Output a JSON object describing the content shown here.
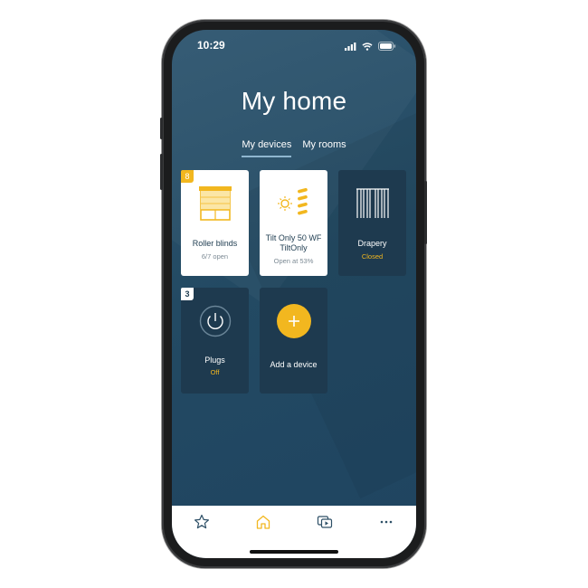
{
  "status_bar": {
    "time": "10:29"
  },
  "header": {
    "title": "My home"
  },
  "tabs": [
    {
      "label": "My devices",
      "active": true
    },
    {
      "label": "My rooms",
      "active": false
    }
  ],
  "devices": [
    {
      "badge": "8",
      "name": "Roller blinds",
      "status": "6/7 open",
      "icon": "roller-blind-icon"
    },
    {
      "name": "Tilt Only 50 WF TiltOnly",
      "status": "Open at 53%",
      "icon": "tilt-sun-icon"
    },
    {
      "name": "Drapery",
      "status": "Closed",
      "icon": "drapery-icon"
    },
    {
      "badge": "3",
      "name": "Plugs",
      "status": "Off",
      "icon": "power-icon"
    },
    {
      "name": "Add a device",
      "icon": "plus-icon"
    }
  ],
  "bottom_nav": [
    {
      "icon": "star-icon"
    },
    {
      "icon": "home-icon",
      "active": true
    },
    {
      "icon": "scenes-icon"
    },
    {
      "icon": "more-icon"
    }
  ],
  "colors": {
    "accent": "#f2b71f",
    "background": "#234a63",
    "card_dark": "#1e3a4f"
  }
}
